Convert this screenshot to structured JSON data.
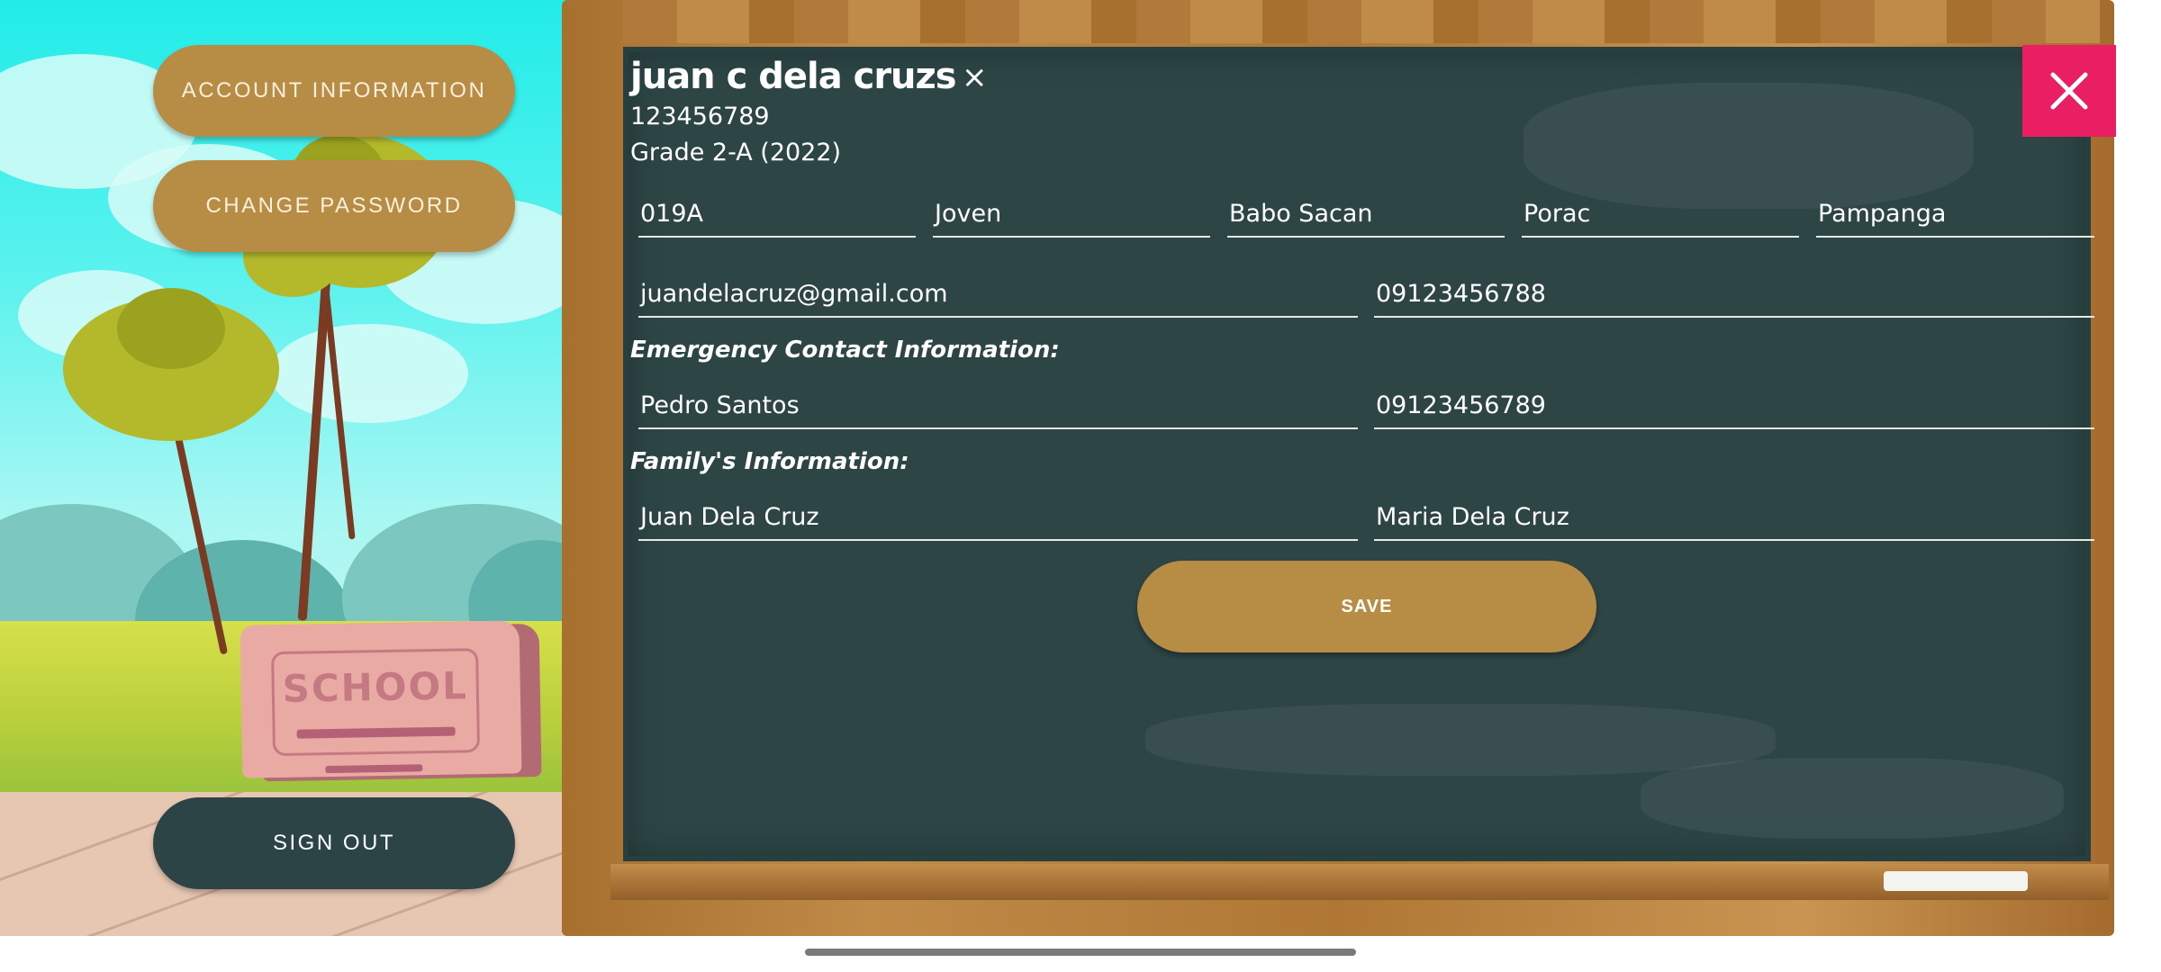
{
  "menu": {
    "account_label": "ACCOUNT INFORMATION",
    "password_label": "CHANGE PASSWORD",
    "signout_label": "SIGN OUT"
  },
  "scene": {
    "sign_text": "SCHOOL"
  },
  "profile": {
    "name": "juan c dela cruzs",
    "student_id": "123456789",
    "grade": "Grade 2-A (2022)"
  },
  "address": {
    "house_no": "019A",
    "street": "Joven",
    "barangay": "Babo Sacan",
    "municipality": "Porac",
    "province": "Pampanga"
  },
  "contact": {
    "email": "juandelacruz@gmail.com",
    "phone": "09123456788"
  },
  "emergency": {
    "heading": "Emergency Contact Information:",
    "name": "Pedro Santos",
    "phone": "09123456789"
  },
  "family": {
    "heading": "Family's Information:",
    "father": "Juan Dela Cruz",
    "mother": "Maria Dela Cruz"
  },
  "actions": {
    "save_label": "SAVE",
    "clear_glyph": "×"
  },
  "colors": {
    "button_gold": "#b78c45",
    "signout_dark": "#2c4446",
    "chalkboard": "#2d4545",
    "close_red": "#e91e63"
  }
}
